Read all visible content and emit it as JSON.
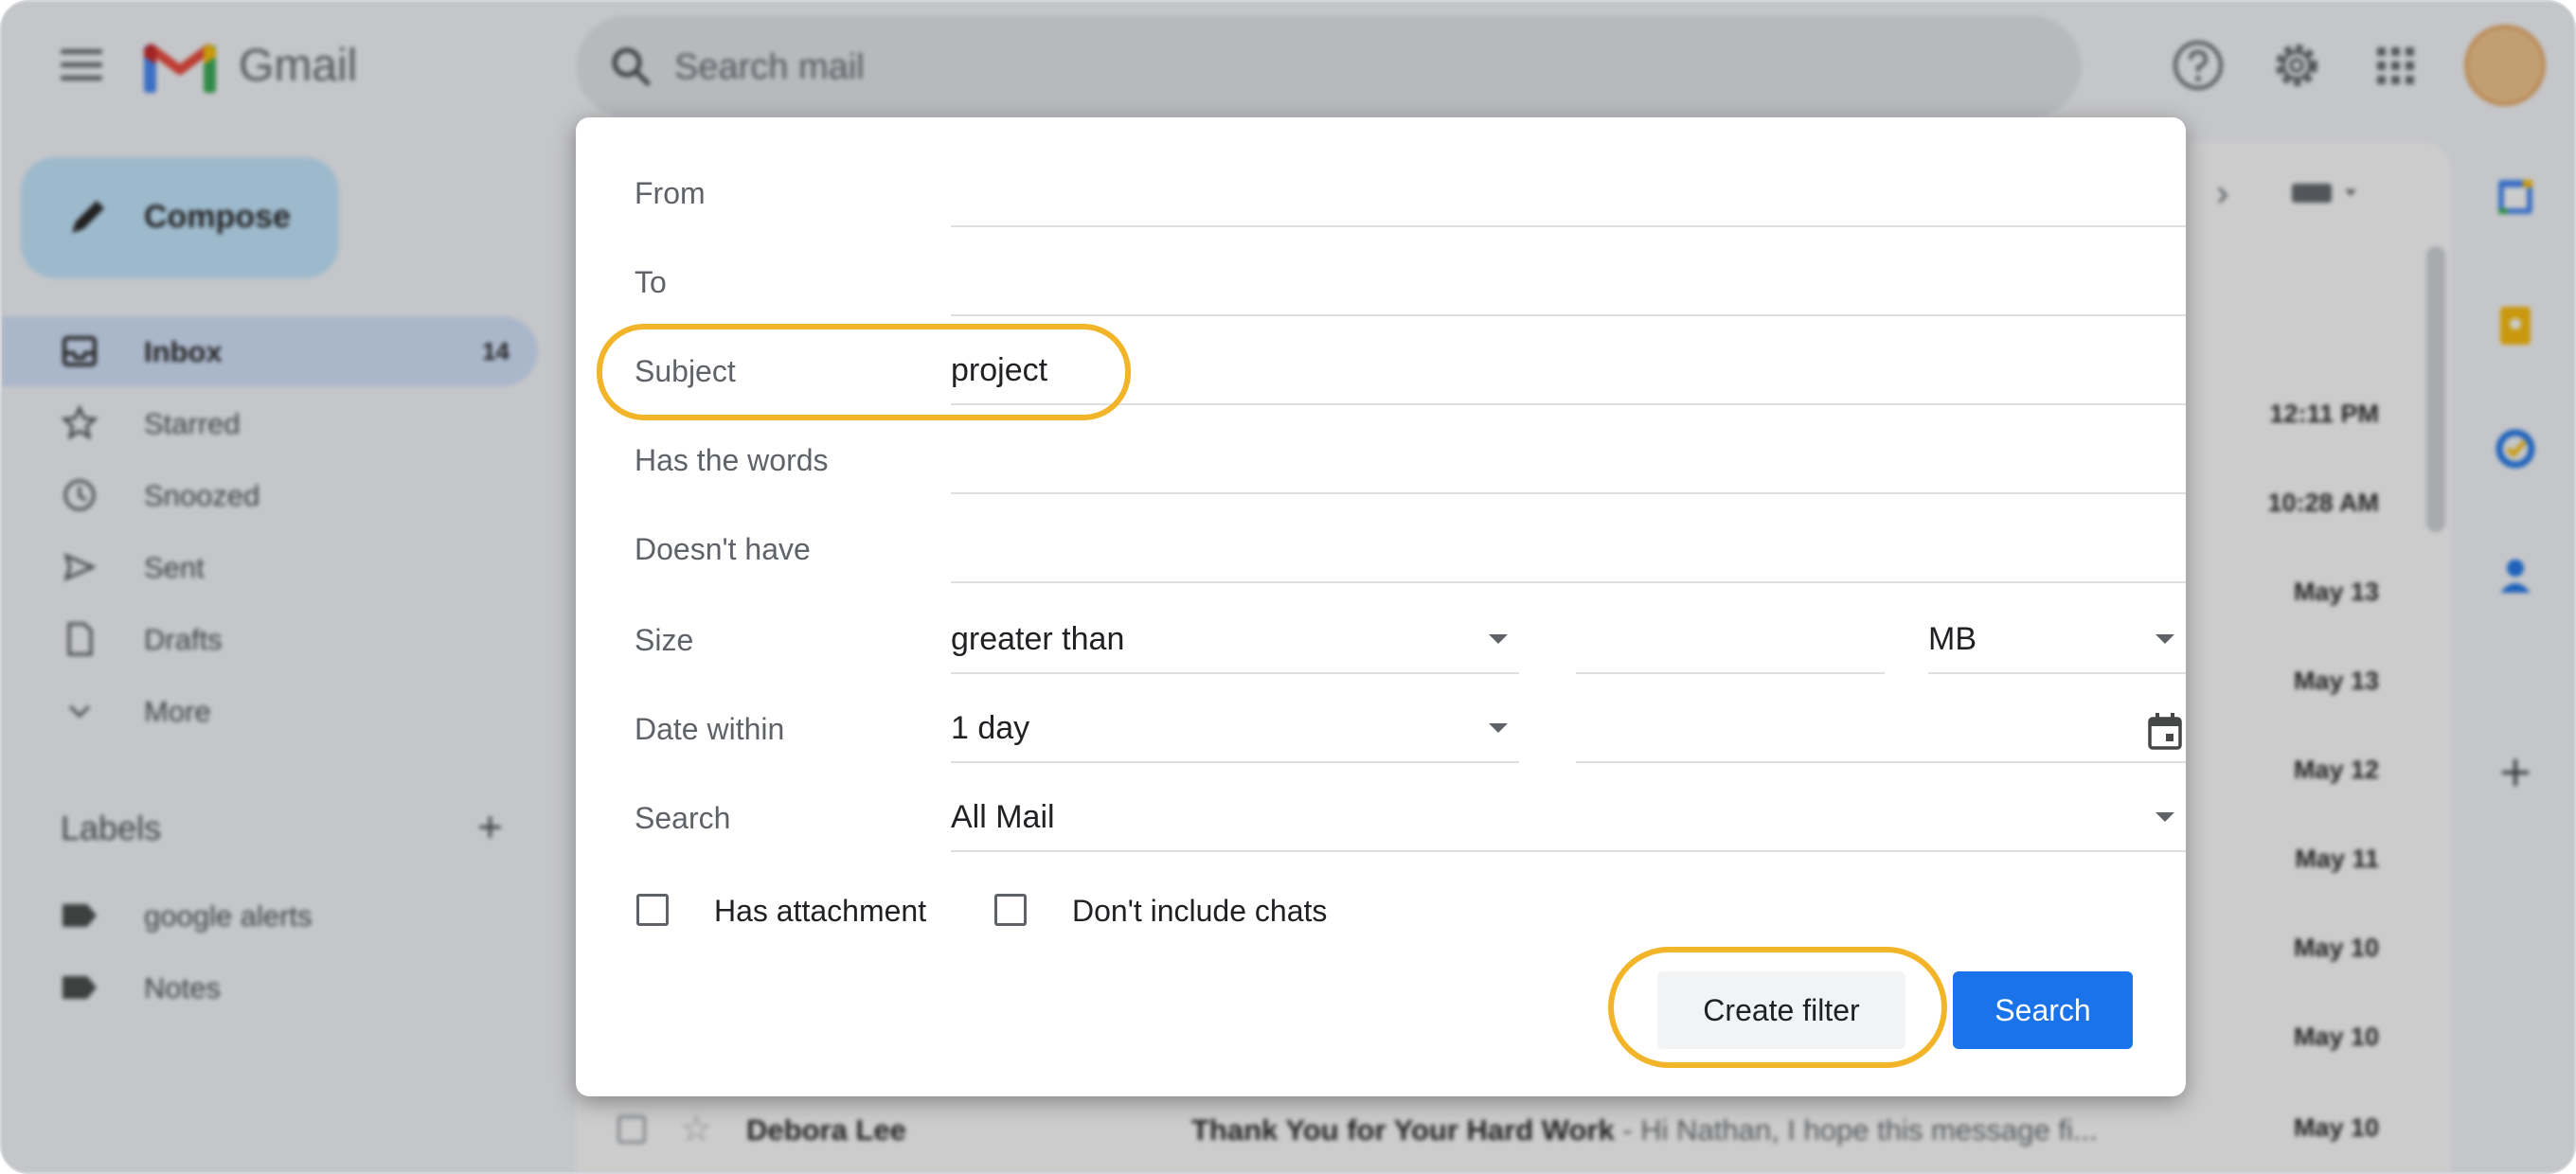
{
  "app": {
    "brand": "Gmail"
  },
  "search": {
    "placeholder": "Search mail"
  },
  "sidebar": {
    "compose_label": "Compose",
    "items": [
      {
        "label": "Inbox",
        "count": "14",
        "icon": "inbox-icon",
        "active": true
      },
      {
        "label": "Starred",
        "icon": "star-icon"
      },
      {
        "label": "Snoozed",
        "icon": "clock-icon"
      },
      {
        "label": "Sent",
        "icon": "send-icon"
      },
      {
        "label": "Drafts",
        "icon": "draft-icon"
      },
      {
        "label": "More",
        "icon": "chevron-down-icon"
      }
    ],
    "labels_heading": "Labels",
    "labels": [
      {
        "label": "google alerts"
      },
      {
        "label": "Notes"
      }
    ]
  },
  "mail_list": {
    "dates": [
      "12:11 PM",
      "10:28 AM",
      "May 13",
      "May 13",
      "May 12",
      "May 11",
      "May 10",
      "May 10",
      "May 10"
    ],
    "last_row": {
      "sender": "Debora Lee",
      "subject": "Thank You for Your Hard Work",
      "snippet": " - Hi Nathan, I hope this message fi..."
    }
  },
  "filter_dialog": {
    "from_label": "From",
    "to_label": "To",
    "subject_label": "Subject",
    "subject_value": "project",
    "has_words_label": "Has the words",
    "doesnt_have_label": "Doesn't have",
    "size_label": "Size",
    "size_operator": "greater than",
    "size_unit": "MB",
    "date_label": "Date within",
    "date_value": "1 day",
    "search_label": "Search",
    "search_scope": "All Mail",
    "has_attachment_label": "Has attachment",
    "no_chats_label": "Don't include chats",
    "create_filter_label": "Create filter",
    "search_button_label": "Search"
  },
  "colors": {
    "accent": "#1a73e8",
    "highlight": "#f2b52a",
    "compose": "#c2e7ff",
    "nav_active": "#d3e3fd"
  }
}
